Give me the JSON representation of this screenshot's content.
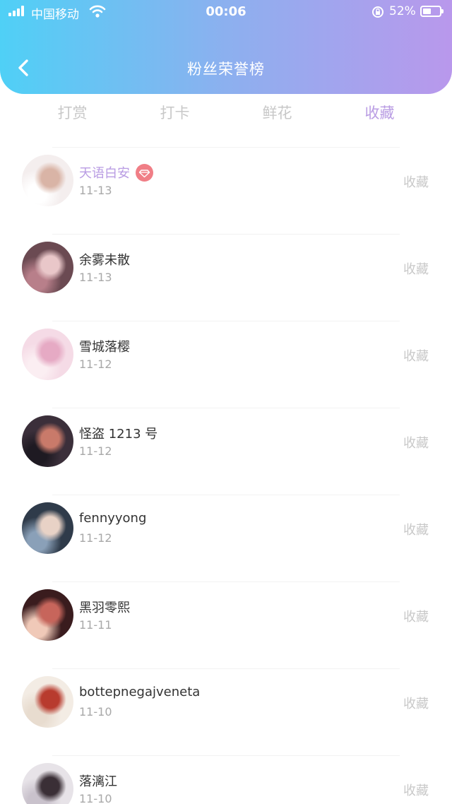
{
  "status_bar": {
    "carrier": "中国移动",
    "time": "00:06",
    "battery_percent": "52%",
    "battery_level": 0.52
  },
  "header": {
    "title": "粉丝荣誉榜",
    "back_icon": "chevron-left-icon",
    "gradient_colors": [
      "#4fd0f6",
      "#8cb0ef",
      "#b998ec"
    ]
  },
  "tabs": [
    {
      "label": "打赏",
      "active": false
    },
    {
      "label": "打卡",
      "active": false
    },
    {
      "label": "鲜花",
      "active": false
    },
    {
      "label": "收藏",
      "active": true
    }
  ],
  "accent_color": "#b99ce3",
  "fans": [
    {
      "name": "天语白安",
      "date": "11-13",
      "action": "收藏",
      "vip": true,
      "avatar_colors": [
        "#f4eeee",
        "#d9b4a6",
        "#ffffff"
      ]
    },
    {
      "name": "余雾未散",
      "date": "11-13",
      "action": "收藏",
      "vip": false,
      "avatar_colors": [
        "#6b4a52",
        "#e9c7c9",
        "#b87f8a"
      ]
    },
    {
      "name": "雪城落樱",
      "date": "11-12",
      "action": "收藏",
      "vip": false,
      "avatar_colors": [
        "#f5dbe6",
        "#e6aac4",
        "#fbeef2"
      ]
    },
    {
      "name": "怪盗 1213 号",
      "date": "11-12",
      "action": "收藏",
      "vip": false,
      "avatar_colors": [
        "#3b2f3a",
        "#c97a6a",
        "#1e1a22"
      ]
    },
    {
      "name": "fennyyong",
      "date": "11-12",
      "action": "收藏",
      "vip": false,
      "avatar_colors": [
        "#2f3b4a",
        "#e8d2c6",
        "#8aa0b8"
      ]
    },
    {
      "name": "黑羽零熙",
      "date": "11-11",
      "action": "收藏",
      "vip": false,
      "avatar_colors": [
        "#3a1c1e",
        "#c7655b",
        "#f0c9b8"
      ]
    },
    {
      "name": "bottepnegajveneta",
      "date": "11-10",
      "action": "收藏",
      "vip": false,
      "avatar_colors": [
        "#f3ece4",
        "#b83b2e",
        "#e8dccf"
      ]
    },
    {
      "name": "落漓江",
      "date": "11-10",
      "action": "收藏",
      "vip": false,
      "avatar_colors": [
        "#e7e3e8",
        "#3a2f36",
        "#c9c2cc"
      ]
    }
  ]
}
